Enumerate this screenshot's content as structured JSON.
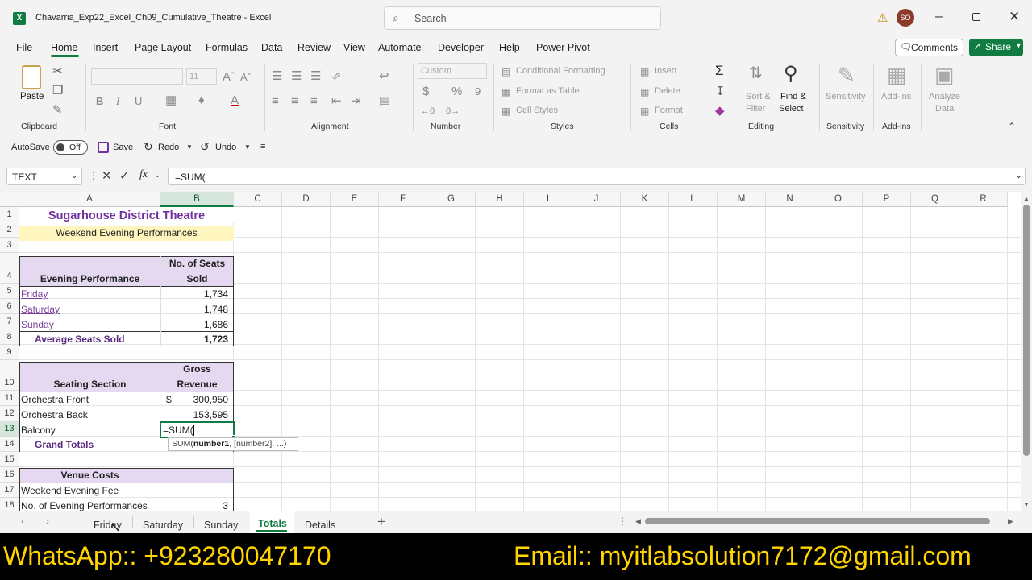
{
  "window": {
    "title": "Chavarria_Exp22_Excel_Ch09_Cumulative_Theatre - Excel",
    "search_placeholder": "Search",
    "user_initials": "SO"
  },
  "menu": [
    "File",
    "Home",
    "Insert",
    "Page Layout",
    "Formulas",
    "Data",
    "Review",
    "View",
    "Automate",
    "Developer",
    "Help",
    "Power Pivot"
  ],
  "buttons": {
    "comments": "Comments",
    "share": "Share"
  },
  "ribbon": {
    "clipboard": {
      "paste": "Paste",
      "group": "Clipboard"
    },
    "font": {
      "size": "11",
      "group": "Font",
      "bold": "B",
      "italic": "I",
      "underline": "U"
    },
    "alignment": {
      "group": "Alignment"
    },
    "number": {
      "format": "Custom",
      "group": "Number",
      "currency": "$",
      "percent": "%",
      "comma": "9"
    },
    "styles": {
      "conditional": "Conditional Formatting",
      "format_table": "Format as Table",
      "cell_styles": "Cell Styles",
      "group": "Styles"
    },
    "cells": {
      "insert": "Insert",
      "delete": "Delete",
      "format": "Format",
      "group": "Cells"
    },
    "editing": {
      "sort_filter_1": "Sort &",
      "sort_filter_2": "Filter",
      "find_select_1": "Find &",
      "find_select_2": "Select",
      "group": "Editing"
    },
    "sensitivity": {
      "label": "Sensitivity",
      "group": "Sensitivity"
    },
    "addins": {
      "label": "Add-ins",
      "group": "Add-ins"
    },
    "analyze": {
      "label1": "Analyze",
      "label2": "Data"
    }
  },
  "qat": {
    "autosave": "AutoSave",
    "toggle": "Off",
    "save": "Save",
    "redo": "Redo",
    "undo": "Undo"
  },
  "formula_bar": {
    "name_box": "TEXT",
    "fx": "fx",
    "formula": "=SUM("
  },
  "columns": [
    "A",
    "B",
    "C",
    "D",
    "E",
    "F",
    "G",
    "H",
    "I",
    "J",
    "K",
    "L",
    "M",
    "N",
    "O",
    "P",
    "Q",
    "R"
  ],
  "rows": [
    "1",
    "2",
    "3",
    "4",
    "5",
    "6",
    "7",
    "8",
    "9",
    "10",
    "11",
    "12",
    "13",
    "14",
    "15",
    "16",
    "17",
    "18"
  ],
  "sheet": {
    "title": "Sugarhouse District Theatre",
    "subtitle": "Weekend Evening Performances",
    "h4_a": "Evening Performance",
    "h4_b1": "No. of Seats",
    "h4_b2": "Sold",
    "r5_a": "Friday",
    "r5_b": "1,734",
    "r6_a": "Saturday",
    "r6_b": "1,748",
    "r7_a": "Sunday",
    "r7_b": "1,686",
    "r8_a": "Average Seats Sold",
    "r8_b": "1,723",
    "h10_a": "Seating Section",
    "h10_b1": "Gross",
    "h10_b2": "Revenue",
    "r11_a": "Orchestra Front",
    "r11_cur": "$",
    "r11_b": "300,950",
    "r12_a": "Orchestra Back",
    "r12_b": "153,595",
    "r13_a": "Balcony",
    "r13_b": "=SUM(",
    "r14_a": "Grand Totals",
    "tooltip_fn": "SUM(",
    "tooltip_arg1": "number1",
    "tooltip_rest": ", [number2], ...)",
    "r16_a": "Venue Costs",
    "r17_a": "Weekend Evening Fee",
    "r18_a": "No. of Evening Performances",
    "r18_b": "3"
  },
  "tabs": [
    "Friday",
    "Saturday",
    "Sunday",
    "Totals",
    "Details"
  ],
  "active_tab": "Totals",
  "footer": {
    "whatsapp": "WhatsApp:: +923280047170",
    "email": "Email:: myitlabsolution7172@gmail.com"
  },
  "colors": {
    "excel_green": "#107c41",
    "header_purple": "#e4d9f0",
    "title_purple": "#7030a0",
    "yellow": "#fff5bf",
    "footer_text": "#ffd400"
  }
}
